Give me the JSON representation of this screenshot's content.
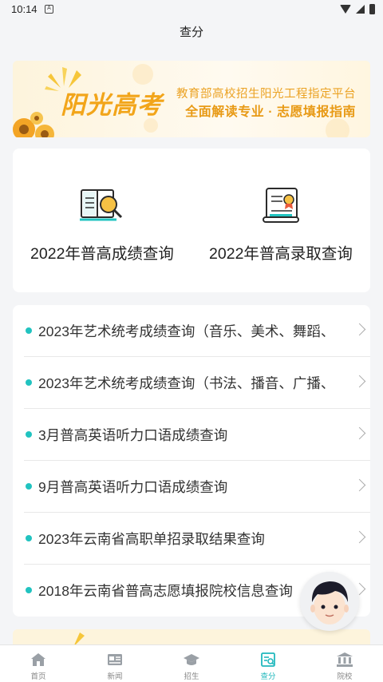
{
  "status_bar": {
    "time": "10:14",
    "notification": "A"
  },
  "header": {
    "title": "查分"
  },
  "banner": {
    "logo_text": "阳光高考",
    "line1": "教育部高校招生阳光工程指定平台",
    "line2": "全面解读专业 · 志愿填报指南"
  },
  "quick_queries": [
    {
      "label": "2022年普高成绩查询",
      "icon": "book-magnifier-icon"
    },
    {
      "label": "2022年普高录取查询",
      "icon": "certificate-scroll-icon"
    }
  ],
  "query_list": [
    {
      "label": "2023年艺术统考成绩查询（音乐、美术、舞蹈、"
    },
    {
      "label": "2023年艺术统考成绩查询（书法、播音、广播、"
    },
    {
      "label": "3月普高英语听力口语成绩查询"
    },
    {
      "label": "9月普高英语听力口语成绩查询"
    },
    {
      "label": "2023年云南省高职单招录取结果查询"
    },
    {
      "label": "2018年云南省普高志愿填报院校信息查询"
    }
  ],
  "bottom_nav": [
    {
      "label": "首页",
      "icon": "home-icon",
      "active": false
    },
    {
      "label": "新闻",
      "icon": "news-icon",
      "active": false
    },
    {
      "label": "招生",
      "icon": "graduation-cap-icon",
      "active": false
    },
    {
      "label": "查分",
      "icon": "score-query-icon",
      "active": true
    },
    {
      "label": "院校",
      "icon": "college-icon",
      "active": false
    }
  ],
  "colors": {
    "accent": "#21c3c0",
    "banner_orange": "#f2a51a"
  }
}
